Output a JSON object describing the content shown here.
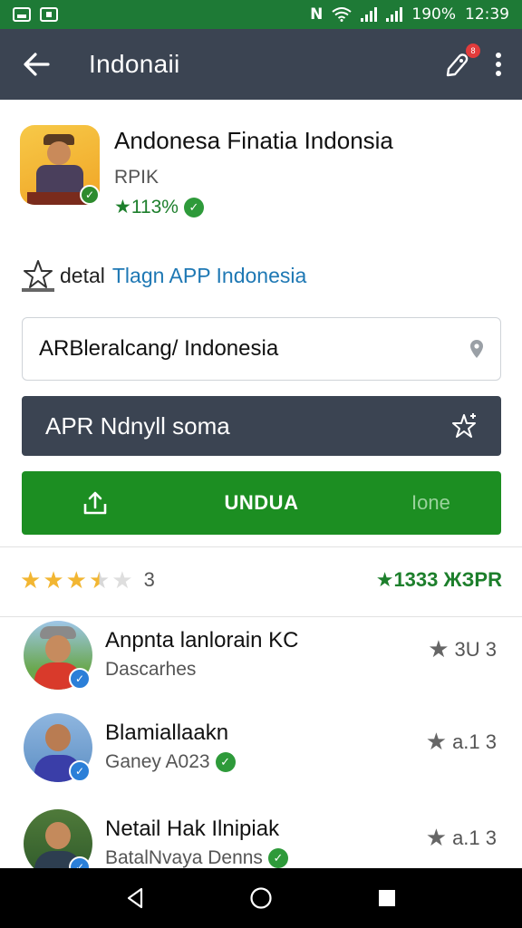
{
  "status_bar": {
    "battery": "190%",
    "time": "12:39",
    "bg_color": "#1e7a36"
  },
  "app_bar": {
    "title": "Indonaii",
    "bg_color": "#3b4452",
    "badge_count": "8"
  },
  "app": {
    "name": "Andonesa Finatia Indonsia",
    "developer": "RPIK",
    "rating_text": "★113%"
  },
  "detail": {
    "label": "detal",
    "link": "Tlagn APP Indonesia"
  },
  "search_field": {
    "value": "ARBleralcang/ Indonesia"
  },
  "dark_button": {
    "label": "APR Ndnyll soma"
  },
  "green_button": {
    "label": "UNDUA",
    "side_label": "Ione",
    "bg_color": "#1c8e22"
  },
  "rating_summary": {
    "stars": 3.5,
    "count": "3",
    "right_text": "★1333 ЖЗPR"
  },
  "reviews": [
    {
      "name": "Anpnta lanlorain KC",
      "sub": "Dascarhes",
      "rating": "3U  3",
      "sub_check": false
    },
    {
      "name": "Blamiallaakn",
      "sub": "Ganey A023",
      "rating": "a.1  3",
      "sub_check": true
    },
    {
      "name": "Netail Hak Ilnipiak",
      "sub": "BatalNvaya Denns",
      "rating": "a.1  3",
      "sub_check": true
    }
  ]
}
